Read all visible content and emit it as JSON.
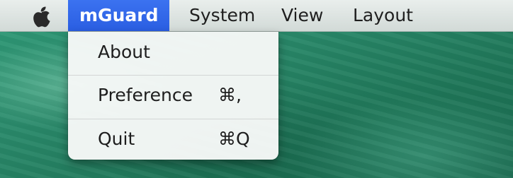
{
  "menubar": {
    "apple_icon": "apple-logo-icon",
    "items": [
      {
        "label": "mGuard",
        "active": true
      },
      {
        "label": "System",
        "active": false
      },
      {
        "label": "View",
        "active": false
      },
      {
        "label": "Layout",
        "active": false
      }
    ]
  },
  "dropdown": {
    "items": [
      {
        "label": "About",
        "shortcut": ""
      },
      {
        "label": "Preference",
        "shortcut": "⌘,"
      },
      {
        "label": "Quit",
        "shortcut": "⌘Q"
      }
    ]
  },
  "colors": {
    "menu_highlight": "#2f64e6",
    "menubar": "#dde3e1",
    "desktop": "#278463"
  }
}
